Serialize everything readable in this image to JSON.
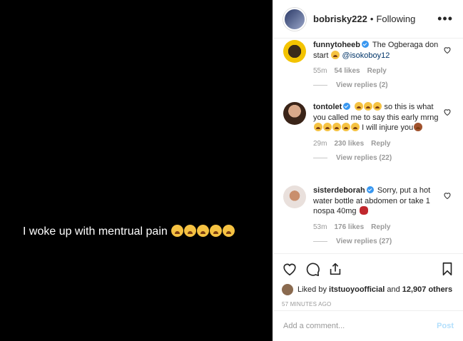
{
  "media": {
    "caption": "I woke up with mentrual pain",
    "caption_emojis": 5
  },
  "header": {
    "username": "bobrisky222",
    "separator": "•",
    "follow_status": "Following",
    "more_icon": "more-dots-icon"
  },
  "comments": [
    {
      "username": "funnytoheeb",
      "text": "The Ogberaga don start",
      "mention": "@isokoboy12",
      "time": "55m",
      "likes": "54 likes",
      "reply": "Reply",
      "view_replies": "View replies (2)"
    },
    {
      "username": "tontolet",
      "text_a": "so this is what you called me to say this early mrng",
      "text_b": "I will injure you",
      "time": "29m",
      "likes": "230 likes",
      "reply": "Reply",
      "view_replies": "View replies (22)"
    },
    {
      "username": "sisterdeborah",
      "text": "Sorry, put a hot water bottle at abdomen or take 1 nospa 40mg",
      "time": "53m",
      "likes": "176 likes",
      "reply": "Reply",
      "view_replies": "View replies (27)"
    }
  ],
  "actions": {
    "icons": [
      "heart-icon",
      "comment-icon",
      "share-icon",
      "bookmark-icon"
    ],
    "liked_by_prefix": "Liked by",
    "liked_by_user": "itstuoyoofficial",
    "liked_by_and": "and",
    "liked_by_count": "12,907 others",
    "time_ago": "57 MINUTES AGO"
  },
  "add_comment": {
    "placeholder": "Add a comment...",
    "post_label": "Post"
  },
  "colors": {
    "verified": "#3897f0",
    "mention": "#003569",
    "post_disabled": "#b2dffc",
    "muted": "#999999"
  }
}
